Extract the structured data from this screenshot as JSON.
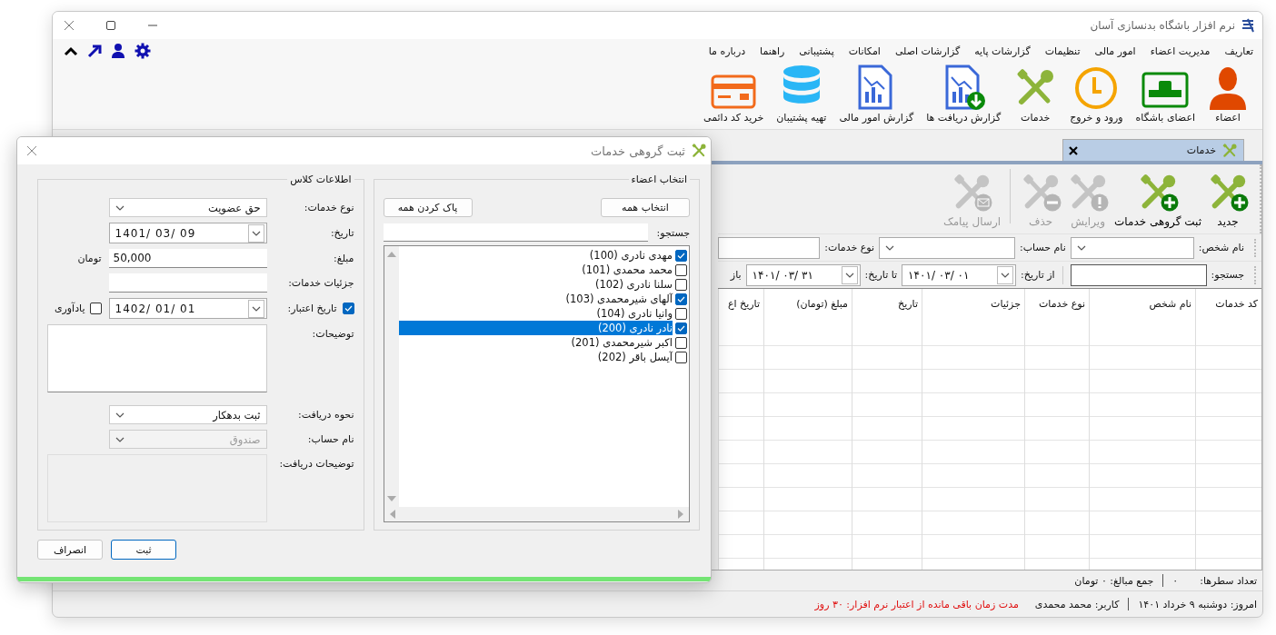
{
  "window": {
    "title": "نرم افزار باشگاه بدنسازی آسان"
  },
  "menu": [
    "تعاریف",
    "مدیریت اعضاء",
    "امور مالی",
    "تنظیمات",
    "گزارشات پایه",
    "گزارشات اصلی",
    "امکانات",
    "پشتیبانی",
    "راهنما",
    "درباره ما"
  ],
  "ribbon": [
    {
      "label": "اعضاء",
      "kind": "person"
    },
    {
      "label": "اعضای باشگاه",
      "kind": "card"
    },
    {
      "label": "ورود و خروج",
      "kind": "clock"
    },
    {
      "label": "خدمات",
      "kind": "tools"
    },
    {
      "label": "گزارش دریافت ها",
      "kind": "report-down"
    },
    {
      "label": "گزارش امور مالی",
      "kind": "report"
    },
    {
      "label": "تهیه پشتیبان",
      "kind": "database"
    },
    {
      "label": "خرید کد دائمی",
      "kind": "payment-card"
    }
  ],
  "tabs": [
    {
      "label": "خدمات",
      "selected": true
    }
  ],
  "toolbar": [
    {
      "label": "جدید",
      "kind": "add",
      "disabled": false
    },
    {
      "label": "ثبت گروهی خدمات",
      "kind": "add",
      "disabled": false
    },
    {
      "label": "ویرایش",
      "kind": "edit",
      "disabled": true
    },
    {
      "label": "حذف",
      "kind": "remove",
      "disabled": true
    },
    {
      "label": "ارسال پیامک",
      "kind": "mail",
      "disabled": true
    }
  ],
  "filters": {
    "person_label": "نام شخص:",
    "account_label": "نام حساب:",
    "service_type_label": "نوع خدمات:",
    "search_label": "جستجو:",
    "from_label": "از تاریخ:",
    "from_value": "۱۴۰۱/ ۰۳/ ۰۱",
    "to_label": "تا تاریخ:",
    "to_value": "۱۴۰۱/ ۰۳/ ۳۱",
    "cut_label": "باز"
  },
  "table": {
    "columns": [
      "کد خدمات",
      "نام شخص",
      "نوع خدمات",
      "جزئیات",
      "تاریخ",
      "مبلغ (تومان)",
      "تاریخ اع"
    ]
  },
  "summary": {
    "row_count_label": "تعداد سطرها:",
    "row_count": "۰",
    "total": "جمع مبالغ: ۰ تومان"
  },
  "status_bar": {
    "today": "امروز: دوشنبه ۹ خرداد ۱۴۰۱",
    "user": "کاربر: محمد محمدی",
    "license": "مدت زمان باقی مانده از اعتبار نرم افزار: ۳۰ روز"
  },
  "dialog": {
    "title": "ثبت گروهی خدمات",
    "members_group": {
      "title": "انتخاب اعضاء",
      "select_all": "انتخاب همه",
      "clear_all": "پاک کردن همه",
      "search_label": "جستجو:",
      "items": [
        {
          "label": "مهدی نادری (100)",
          "checked": true,
          "selected": false
        },
        {
          "label": "محمد محمدی (101)",
          "checked": false,
          "selected": false
        },
        {
          "label": "سلنا نادری (102)",
          "checked": false,
          "selected": false
        },
        {
          "label": "آلهای شیرمحمدی (103)",
          "checked": true,
          "selected": false
        },
        {
          "label": "وانیا نادری (104)",
          "checked": false,
          "selected": false
        },
        {
          "label": "نادر نادری (200)",
          "checked": true,
          "selected": true
        },
        {
          "label": "اکبر شیرمحمدی (201)",
          "checked": false,
          "selected": false
        },
        {
          "label": "آیسل باقر (202)",
          "checked": false,
          "selected": false
        }
      ]
    },
    "info_group": {
      "title": "اطلاعات کلاس",
      "fields": [
        {
          "kind": "combo",
          "label": "نوع خدمات:",
          "value": "حق عضویت",
          "disabled": false
        },
        {
          "kind": "date",
          "label": "تاریخ:",
          "value": "1401/ 03/ 09"
        },
        {
          "kind": "text",
          "label": "مبلغ:",
          "value": "50,000",
          "suffix": "تومان"
        },
        {
          "kind": "text",
          "label": "جزئیات خدمات:"
        },
        {
          "kind": "date",
          "label": "تاریخ اعتبار:",
          "value": "1402/ 01/ 01",
          "checked": true,
          "reminder": {
            "label": "یادآوری",
            "checked": false
          }
        },
        {
          "kind": "textarea",
          "label": "توضیحات:",
          "disabled": false
        },
        {
          "kind": "combo",
          "label": "نحوه دریافت:",
          "value": "ثبت بدهکار",
          "disabled": false
        },
        {
          "kind": "combo",
          "label": "نام حساب:",
          "value": "صندوق",
          "disabled": true
        },
        {
          "kind": "textarea",
          "label": "توضیحات دریافت:",
          "disabled": true
        }
      ]
    },
    "buttons": [
      {
        "label": "ثبت",
        "default": true
      },
      {
        "label": "انصراف",
        "default": false
      }
    ],
    "progress": {
      "level": 1
    }
  }
}
